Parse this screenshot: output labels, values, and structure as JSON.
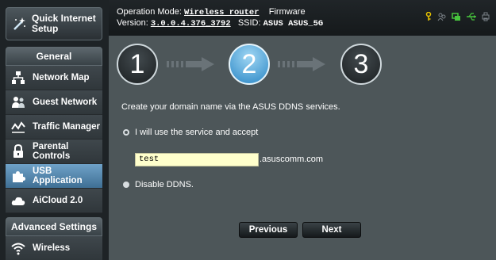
{
  "sidebar": {
    "quick_setup": "Quick Internet Setup",
    "general_heading": "General",
    "general_items": [
      {
        "label": "Network Map",
        "icon": "network-map-icon"
      },
      {
        "label": "Guest Network",
        "icon": "guest-network-icon"
      },
      {
        "label": "Traffic Manager",
        "icon": "traffic-manager-icon"
      },
      {
        "label": "Parental Controls",
        "icon": "lock-icon"
      },
      {
        "label": "USB Application",
        "icon": "usb-puzzle-icon",
        "active": true
      },
      {
        "label": "AiCloud 2.0",
        "icon": "cloud-icon"
      }
    ],
    "advanced_heading": "Advanced Settings",
    "advanced_items": [
      {
        "label": "Wireless",
        "icon": "wifi-icon"
      }
    ]
  },
  "header": {
    "mode_label": "Operation Mode:",
    "mode_value": "Wireless router",
    "firmware_label": "Firmware",
    "version_label": "Version:",
    "version_value": "3.0.0.4.376_3792",
    "ssid_label": "SSID:",
    "ssid_value": "ASUS  ASUS_5G"
  },
  "wizard": {
    "steps": [
      "1",
      "2",
      "3"
    ],
    "current_step": 2,
    "instruction": "Create your domain name via the ASUS DDNS services.",
    "option_use": "I will use the service and accept",
    "hostname_value": "test",
    "domain_suffix": ".asuscomm.com",
    "option_disable": "Disable DDNS.",
    "previous_label": "Previous",
    "next_label": "Next"
  },
  "colors": {
    "active_step": "#2b87c6",
    "input_bg": "#ffffcc",
    "main_bg": "#4d5659"
  }
}
